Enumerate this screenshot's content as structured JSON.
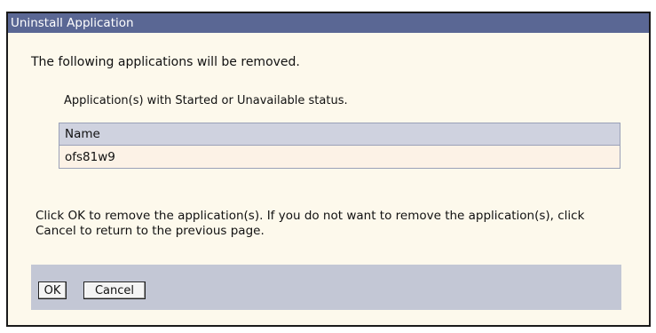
{
  "dialog": {
    "title": "Uninstall Application",
    "intro": "The following applications will be removed.",
    "status_note": "Application(s) with Started or Unavailable status.",
    "table": {
      "header": "Name",
      "rows": [
        "ofs81w9"
      ]
    },
    "instructions": "Click OK to remove the application(s). If you do not want to remove the application(s), click Cancel to return to the previous page.",
    "buttons": {
      "ok_label": "OK",
      "cancel_label": "Cancel"
    }
  },
  "colors": {
    "title_bar": "#5a6794",
    "panel_background": "#fdf9ec",
    "table_header": "#cfd2df",
    "table_row": "#fcf2e6",
    "button_bar": "#c3c7d5"
  }
}
